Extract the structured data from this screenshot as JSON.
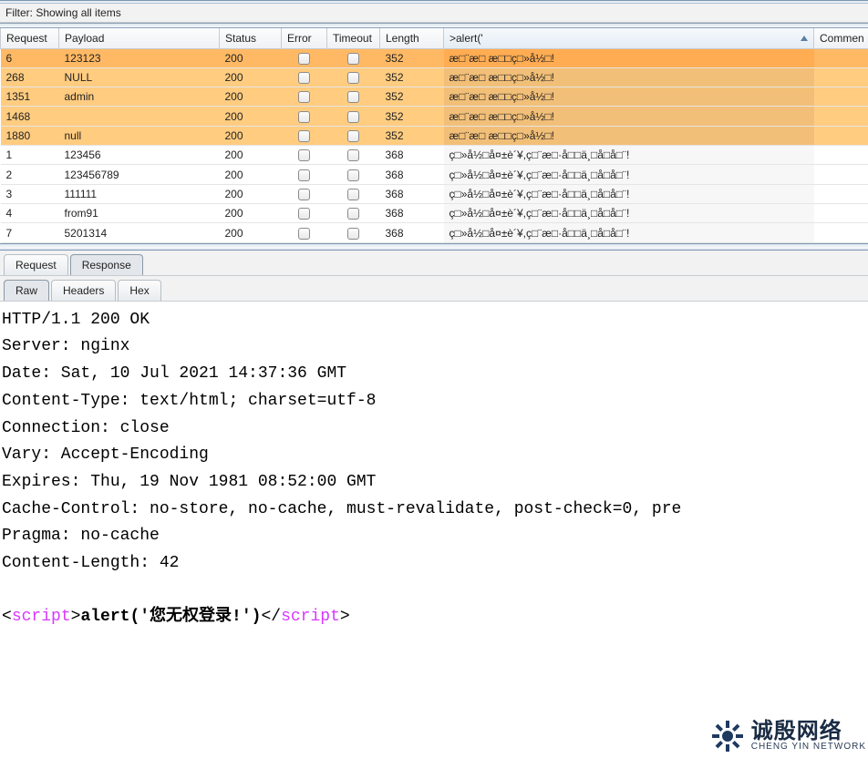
{
  "filter_label": "Filter: Showing all items",
  "columns": {
    "request": "Request",
    "payload": "Payload",
    "status": "Status",
    "error": "Error",
    "timeout": "Timeout",
    "length": "Length",
    "sort": ">alert('",
    "comment": "Commen"
  },
  "rows": [
    {
      "request": "6",
      "payload": "123123",
      "status": "200",
      "length": "352",
      "sort": "æ□¨æ□ æ□□ç□»å½□!",
      "hl": true,
      "sel": true
    },
    {
      "request": "268",
      "payload": "NULL",
      "status": "200",
      "length": "352",
      "sort": "æ□¨æ□ æ□□ç□»å½□!",
      "hl": true
    },
    {
      "request": "1351",
      "payload": "admin",
      "status": "200",
      "length": "352",
      "sort": "æ□¨æ□ æ□□ç□»å½□!",
      "hl": true
    },
    {
      "request": "1468",
      "payload": "",
      "status": "200",
      "length": "352",
      "sort": "æ□¨æ□ æ□□ç□»å½□!",
      "hl": true
    },
    {
      "request": "1880",
      "payload": "null",
      "status": "200",
      "length": "352",
      "sort": "æ□¨æ□ æ□□ç□»å½□!",
      "hl": true
    },
    {
      "request": "1",
      "payload": "123456",
      "status": "200",
      "length": "368",
      "sort": "ç□»å½□å¤±è´¥,ç□¨æ□·å□□ä¸□å­□å□¨!"
    },
    {
      "request": "2",
      "payload": "123456789",
      "status": "200",
      "length": "368",
      "sort": "ç□»å½□å¤±è´¥,ç□¨æ□·å□□ä¸□å­□å□¨!"
    },
    {
      "request": "3",
      "payload": "111111",
      "status": "200",
      "length": "368",
      "sort": "ç□»å½□å¤±è´¥,ç□¨æ□·å□□ä¸□å­□å□¨!"
    },
    {
      "request": "4",
      "payload": "from91",
      "status": "200",
      "length": "368",
      "sort": "ç□»å½□å¤±è´¥,ç□¨æ□·å□□ä¸□å­□å□¨!"
    },
    {
      "request": "7",
      "payload": "5201314",
      "status": "200",
      "length": "368",
      "sort": "ç□»å½□å¤±è´¥,ç□¨æ□·å□□ä¸□å­□å□¨!"
    }
  ],
  "tabs_upper": {
    "request": "Request",
    "response": "Response"
  },
  "tabs_lower": {
    "raw": "Raw",
    "headers": "Headers",
    "hex": "Hex"
  },
  "raw_lines": [
    "HTTP/1.1 200 OK",
    "Server: nginx",
    "Date: Sat, 10 Jul 2021 14:37:36 GMT",
    "Content-Type: text/html; charset=utf-8",
    "Connection: close",
    "Vary: Accept-Encoding",
    "Expires: Thu, 19 Nov 1981 08:52:00 GMT",
    "Cache-Control: no-store, no-cache, must-revalidate, post-check=0, pre",
    "Pragma: no-cache",
    "Content-Length: 42"
  ],
  "script_line": {
    "open": "<",
    "tag1": "script",
    "gt": ">",
    "call": "alert('您无权登录!')",
    "lt2": "</",
    "tag2": "script",
    "close": ">"
  },
  "watermark": {
    "cn": "诚殷网络",
    "en": "CHENG YIN NETWORK"
  }
}
